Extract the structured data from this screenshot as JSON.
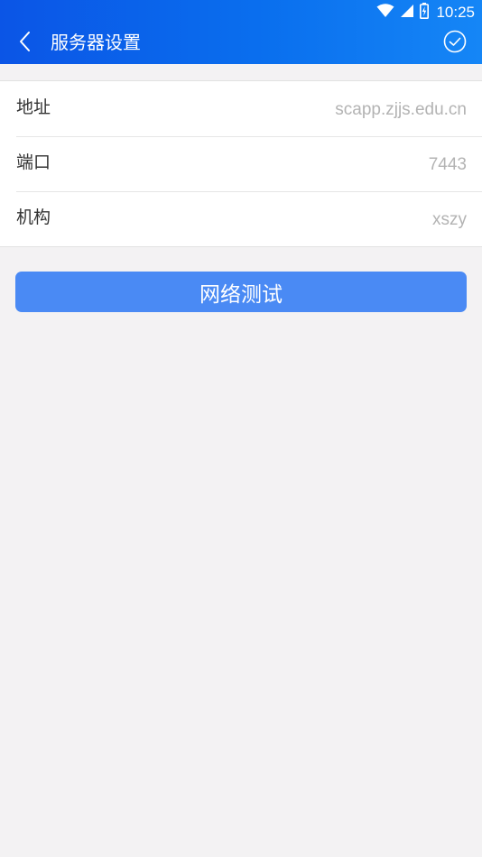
{
  "status_bar": {
    "time": "10:25",
    "icons": [
      "wifi-icon",
      "cell-signal-icon",
      "battery-icon"
    ]
  },
  "header": {
    "title": "服务器设置",
    "back_icon": "chevron-left-icon",
    "confirm_icon": "check-circle-icon"
  },
  "settings": [
    {
      "label": "地址",
      "value": "scapp.zjjs.edu.cn"
    },
    {
      "label": "端口",
      "value": "7443"
    },
    {
      "label": "机构",
      "value": "xszy"
    }
  ],
  "actions": {
    "test_button_label": "网络测试"
  },
  "colors": {
    "header_gradient_start": "#0b55e6",
    "header_gradient_end": "#1586f6",
    "button": "#4a8af4",
    "background": "#f3f2f3",
    "value_text": "#b3b3b3"
  }
}
